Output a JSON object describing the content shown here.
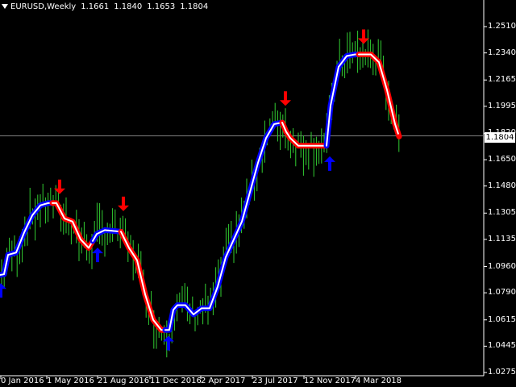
{
  "header": {
    "symbol": "EURUSD,Weekly",
    "open": "1.1661",
    "high": "1.1840",
    "low": "1.1653",
    "close": "1.1804"
  },
  "current_price": "1.1804",
  "colors": {
    "background": "#000000",
    "candle": "#32cd32",
    "trend_up": "#0000ff",
    "trend_down": "#ff0000",
    "arrow_up": "#0000ff",
    "arrow_down": "#ff0000",
    "axis": "#ffffff"
  },
  "chart_data": {
    "type": "line",
    "title": "",
    "price_ticks": [
      "1.2510",
      "1.2340",
      "1.2165",
      "1.1995",
      "1.1820",
      "1.1650",
      "1.1480",
      "1.1305",
      "1.1135",
      "1.0960",
      "1.0790",
      "1.0615",
      "1.0445",
      "1.0275"
    ],
    "time_ticks": [
      "0 Jan 2016",
      "1 May 2016",
      "21 Aug 2016",
      "11 Dec 2016",
      "2 Apr 2017",
      "23 Jul 2017",
      "12 Nov 2017",
      "4 Mar 2018"
    ],
    "ylim": [
      1.0275,
      1.251
    ],
    "series": [
      {
        "points": [
          [
            0,
            1.0905
          ],
          [
            5,
            1.091
          ],
          [
            10,
            1.1035
          ],
          [
            20,
            1.105
          ],
          [
            30,
            1.118
          ],
          [
            40,
            1.129
          ],
          [
            50,
            1.1355
          ],
          [
            60,
            1.137
          ],
          [
            70,
            1.137
          ],
          [
            80,
            1.127
          ],
          [
            90,
            1.125
          ],
          [
            100,
            1.1135
          ],
          [
            110,
            1.108
          ],
          [
            120,
            1.117
          ],
          [
            130,
            1.1195
          ],
          [
            140,
            1.119
          ],
          [
            150,
            1.1185
          ],
          [
            160,
            1.108
          ],
          [
            170,
            1.1
          ],
          [
            180,
            1.078
          ],
          [
            190,
            1.0615
          ],
          [
            200,
            1.055
          ],
          [
            210,
            1.055
          ],
          [
            215,
            1.068
          ],
          [
            220,
            1.071
          ],
          [
            230,
            1.071
          ],
          [
            240,
            1.065
          ],
          [
            250,
            1.069
          ],
          [
            260,
            1.069
          ],
          [
            270,
            1.083
          ],
          [
            280,
            1.102
          ],
          [
            290,
            1.1135
          ],
          [
            300,
            1.125
          ],
          [
            310,
            1.144
          ],
          [
            320,
            1.163
          ],
          [
            330,
            1.179
          ],
          [
            340,
            1.188
          ],
          [
            350,
            1.189
          ],
          [
            355,
            1.183
          ],
          [
            360,
            1.179
          ],
          [
            370,
            1.174
          ],
          [
            380,
            1.174
          ],
          [
            390,
            1.174
          ],
          [
            405,
            1.174
          ],
          [
            410,
            1.2
          ],
          [
            420,
            1.225
          ],
          [
            430,
            1.232
          ],
          [
            440,
            1.233
          ],
          [
            450,
            1.233
          ],
          [
            460,
            1.233
          ],
          [
            470,
            1.228
          ],
          [
            480,
            1.21
          ],
          [
            490,
            1.188
          ],
          [
            495,
            1.18
          ]
        ],
        "segments": [
          {
            "trend": "up",
            "x_from": 0,
            "x_to": 65
          },
          {
            "trend": "down",
            "x_from": 65,
            "x_to": 115
          },
          {
            "trend": "up",
            "x_from": 115,
            "x_to": 150
          },
          {
            "trend": "down",
            "x_from": 150,
            "x_to": 205
          },
          {
            "trend": "up",
            "x_from": 205,
            "x_to": 350
          },
          {
            "trend": "down",
            "x_from": 350,
            "x_to": 405
          },
          {
            "trend": "up",
            "x_from": 405,
            "x_to": 445
          },
          {
            "trend": "down",
            "x_from": 445,
            "x_to": 495
          }
        ]
      }
    ],
    "signals": [
      {
        "type": "up",
        "x": 0,
        "price": 1.08
      },
      {
        "type": "down",
        "x": 73,
        "price": 1.148
      },
      {
        "type": "up",
        "x": 120,
        "price": 1.103
      },
      {
        "type": "down",
        "x": 152,
        "price": 1.137
      },
      {
        "type": "up",
        "x": 208,
        "price": 1.046
      },
      {
        "type": "down",
        "x": 353,
        "price": 1.205
      },
      {
        "type": "up",
        "x": 408,
        "price": 1.162
      },
      {
        "type": "down",
        "x": 450,
        "price": 1.245
      }
    ]
  }
}
